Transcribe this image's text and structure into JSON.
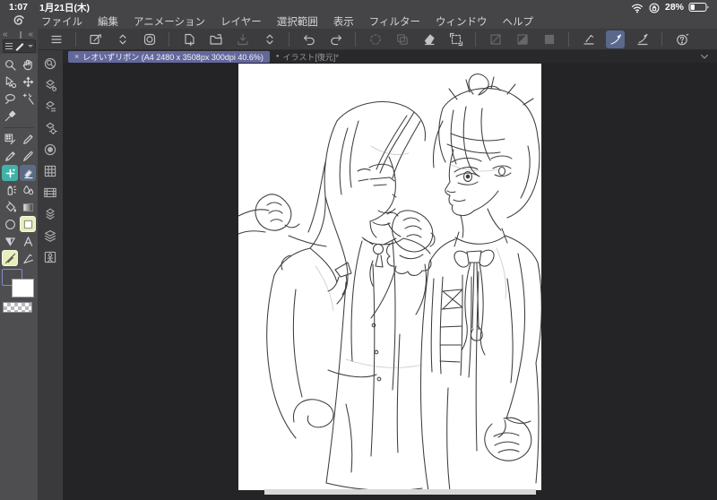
{
  "status_bar": {
    "time": "1:07",
    "date": "1月21日(木)",
    "battery": "28%"
  },
  "menu_bar": {
    "items": [
      "ファイル",
      "編集",
      "アニメーション",
      "レイヤー",
      "選択範囲",
      "表示",
      "フィルター",
      "ウィンドウ",
      "ヘルプ"
    ]
  },
  "command_bar": {
    "groups": [
      [
        {
          "name": "palette-menu"
        }
      ],
      [
        {
          "name": "edit-canvas"
        },
        {
          "name": "size-updown"
        },
        {
          "name": "companion-device"
        }
      ],
      [
        {
          "name": "new-document"
        },
        {
          "name": "open-file"
        },
        {
          "name": "save-file",
          "disabled": true
        },
        {
          "name": "file-updown"
        }
      ],
      [
        {
          "name": "undo"
        },
        {
          "name": "redo"
        }
      ],
      [
        {
          "name": "processing",
          "disabled": true
        },
        {
          "name": "duplicate-layer",
          "disabled": true
        },
        {
          "name": "clear"
        },
        {
          "name": "transform"
        }
      ],
      [
        {
          "name": "deselect",
          "disabled": true
        },
        {
          "name": "invert-selection",
          "disabled": true
        },
        {
          "name": "fill-selection",
          "disabled": true
        }
      ],
      [
        {
          "name": "snap-ruler"
        },
        {
          "name": "snap-special",
          "selected": true
        },
        {
          "name": "snap-guide"
        }
      ],
      [
        {
          "name": "help"
        }
      ]
    ]
  },
  "tab_bar": {
    "active": {
      "close": "×",
      "label": "レオいずリボン (A4 2480 x 3508px 300dpi 40.6%)"
    },
    "inactive": {
      "bullet": "●",
      "label": "イラスト[復元]*"
    }
  },
  "palette_corner": {
    "collapse_left": "«",
    "grip": "❙",
    "collapse_right": "«"
  },
  "tool_palette": {
    "rows": [
      [
        "zoom",
        "hand"
      ],
      [
        "object",
        "move"
      ],
      [
        "lasso",
        "wand"
      ],
      [
        "dropper",
        null
      ],
      "sep",
      [
        "tonepen",
        "pen"
      ],
      [
        "pencil",
        "brush"
      ],
      [
        {
          "name": "deco-plus",
          "bg": "teal"
        },
        {
          "name": "eraser",
          "bg": "slate"
        }
      ],
      [
        "airbrush",
        "blend"
      ],
      [
        "bucket",
        "gradient"
      ],
      [
        "ellipse",
        {
          "name": "figure-rect",
          "bg": "yellow"
        }
      ],
      [
        "polyline",
        "text"
      ],
      [
        {
          "name": "correction-pen",
          "bg": "yellow"
        },
        "ruler"
      ]
    ],
    "swatches": {
      "main_color": "#4c4c4e",
      "sub_color": "#ffffff",
      "transparent": "checker"
    }
  },
  "palette_dock": {
    "items": [
      "quick-access",
      "sub-tool",
      "tool-property",
      "brush-settings",
      "brush-size",
      "color-set",
      "timeline",
      "material",
      "layer",
      "pose"
    ]
  },
  "colors": {
    "active_tab": "#63689b",
    "selected_command": "#5a688c",
    "tool_teal": "#42b2a9",
    "tool_slate": "#5c6b85",
    "tool_yellow": "#e9eebc",
    "swatch_border": "#7d90cc"
  }
}
